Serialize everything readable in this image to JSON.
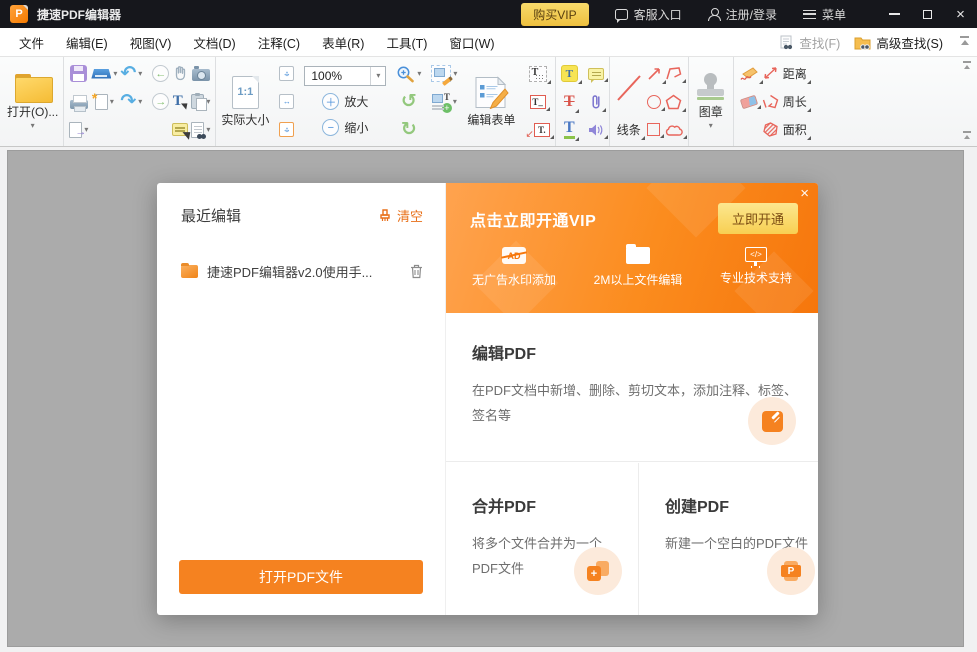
{
  "window": {
    "title": "捷速PDF编辑器",
    "buy_vip": "购买VIP",
    "support": "客服入口",
    "login": "注册/登录",
    "menu": "菜单"
  },
  "menubar": {
    "items": [
      "文件",
      "编辑(E)",
      "视图(V)",
      "文档(D)",
      "注释(C)",
      "表单(R)",
      "工具(T)",
      "窗口(W)"
    ],
    "find": "查找(F)",
    "advanced_find": "高级查找(S)"
  },
  "toolbar": {
    "open": "打开(O)...",
    "actual_size": "实际大小",
    "zoom_value": "100%",
    "zoom_in": "放大",
    "zoom_out": "缩小",
    "edit_form": "编辑表单",
    "line": "线条",
    "stamp": "图章",
    "distance": "距离",
    "perimeter": "周长",
    "area": "面积"
  },
  "dialog": {
    "recent_title": "最近编辑",
    "clear": "清空",
    "recent_file": "捷速PDF编辑器v2.0使用手...",
    "open_pdf": "打开PDF文件",
    "vip": {
      "title": "点击立即开通VIP",
      "cta": "立即开通",
      "features": [
        "无广告水印添加",
        "2M以上文件编辑",
        "专业技术支持"
      ]
    },
    "cards": {
      "edit": {
        "title": "编辑PDF",
        "desc": "在PDF文档中新增、删除、剪切文本，添加注释、标签、签名等"
      },
      "merge": {
        "title": "合并PDF",
        "desc": "将多个文件合并为一个PDF文件"
      },
      "create": {
        "title": "创建PDF",
        "desc": "新建一个空白的PDF文件"
      }
    }
  },
  "glyphs": {
    "app_badge": "P",
    "close": "×",
    "caret": "▾",
    "undo": "↶",
    "redo": "↷",
    "back": "←",
    "forward": "→",
    "rotate_ccw": "↺",
    "rotate_cw": "↻",
    "plus": "＋",
    "minus": "−",
    "one_to_one": "1:1",
    "t": "T",
    "t_underscore": "T_",
    "t_dot": "T.",
    "arrow_sw": "↙",
    "arrow_ne": "↗",
    "export_arrow": "→",
    "fit_h": "↔",
    "fit_v": "↕",
    "ad": "AD",
    "code": "</>",
    "p_badge": "P",
    "plus_small": "+"
  },
  "colors": {
    "accent_orange": "#f58220",
    "vip_gold": "#f3cf5a",
    "banner_from": "#ffa34f",
    "banner_to": "#f6760c",
    "titlebar": "#16171c",
    "workspace_gray": "#ababab"
  }
}
